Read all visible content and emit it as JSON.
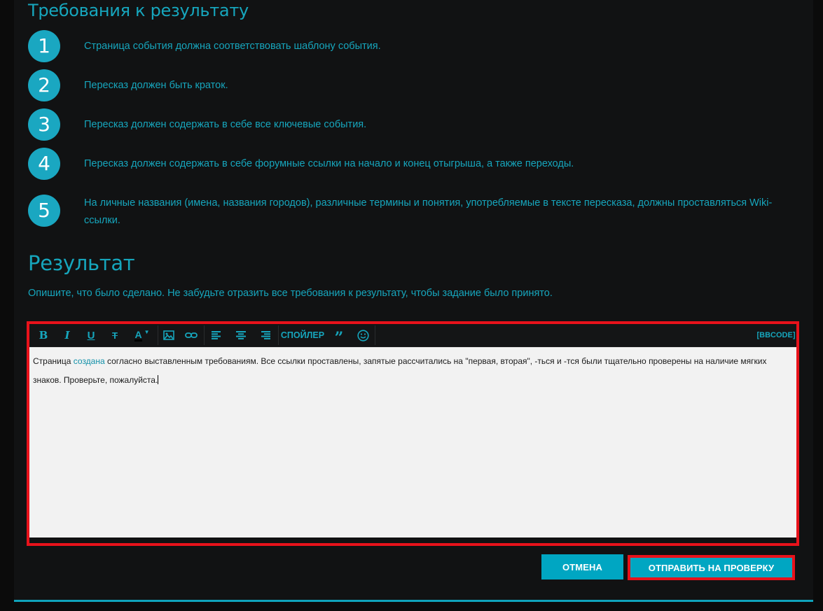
{
  "requirements": {
    "title": "Требования к результату",
    "items": [
      {
        "num": "1",
        "text": "Страница события должна соответствовать шаблону события."
      },
      {
        "num": "2",
        "text": "Пересказ должен быть краток."
      },
      {
        "num": "3",
        "text": "Пересказ должен содержать в себе все ключевые события."
      },
      {
        "num": "4",
        "text": "Пересказ должен содержать в себе форумные ссылки на начало и конец отыгрыша, а также переходы."
      },
      {
        "num": "5",
        "text": "На личные названия (имена, названия городов), различные термины и понятия, употребляемые в тексте пересказа, должны проставляться Wiki-ссылки."
      }
    ]
  },
  "result": {
    "title": "Результат",
    "description": "Опишите, что было сделано. Не забудьте отразить все требования к результату, чтобы задание было принято."
  },
  "toolbar": {
    "bold": "B",
    "italic": "I",
    "underline": "U",
    "strike": "T",
    "color": "A",
    "spoiler": "СПОЙЛЕР",
    "bbcode": "[BBCODE]",
    "icons": [
      "bold-icon",
      "italic-icon",
      "underline-icon",
      "strikethrough-icon",
      "text-color-icon",
      "image-icon",
      "link-icon",
      "align-left-icon",
      "align-center-icon",
      "align-right-icon",
      "quote-icon",
      "smiley-icon"
    ]
  },
  "editor": {
    "text_before_link": "Страница ",
    "link_text": "создана",
    "text_after_link": " согласно выставленным требованиям. Все ссылки проставлены, запятые рассчитались на \"первая, вторая\", -ться и -тся были тщательно проверены на наличие мягких знаков. Проверьте, пожалуйста."
  },
  "buttons": {
    "cancel": "ОТМЕНА",
    "submit": "ОТПРАВИТЬ НА ПРОВЕРКУ"
  },
  "colors": {
    "accent": "#16a6bd",
    "button": "#00a6c2",
    "highlight": "#e8121b",
    "background": "#111213"
  }
}
